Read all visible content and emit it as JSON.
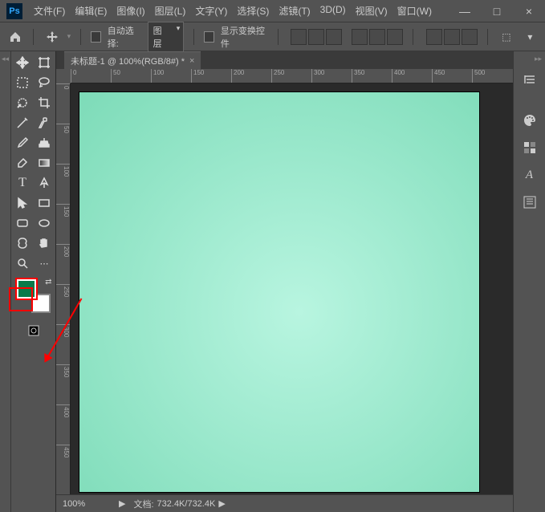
{
  "app": {
    "logo_text": "Ps"
  },
  "menu": {
    "items": [
      "文件(F)",
      "编辑(E)",
      "图像(I)",
      "图层(L)",
      "文字(Y)",
      "选择(S)",
      "滤镜(T)",
      "3D(D)",
      "视图(V)",
      "窗口(W)"
    ]
  },
  "win_controls": {
    "min": "—",
    "max": "□",
    "close": "×"
  },
  "options": {
    "auto_select_label": "自动选择:",
    "auto_select_dropdown": "图层",
    "show_transform_label": "显示变换控件"
  },
  "doc_tab": {
    "title": "未标题-1 @ 100%(RGB/8#) *",
    "close": "×"
  },
  "ruler": {
    "h_ticks": [
      "0",
      "50",
      "100",
      "150",
      "200",
      "250",
      "300",
      "350",
      "400",
      "450",
      "500"
    ],
    "v_ticks": [
      "0",
      "50",
      "100",
      "150",
      "200",
      "250",
      "300",
      "350",
      "400",
      "450"
    ]
  },
  "status": {
    "zoom": "100%",
    "doc_label": "文档:",
    "doc_size": "732.4K/732.4K",
    "expand": "▶"
  },
  "colors": {
    "foreground": "#0a7a4a",
    "background": "#ffffff"
  }
}
